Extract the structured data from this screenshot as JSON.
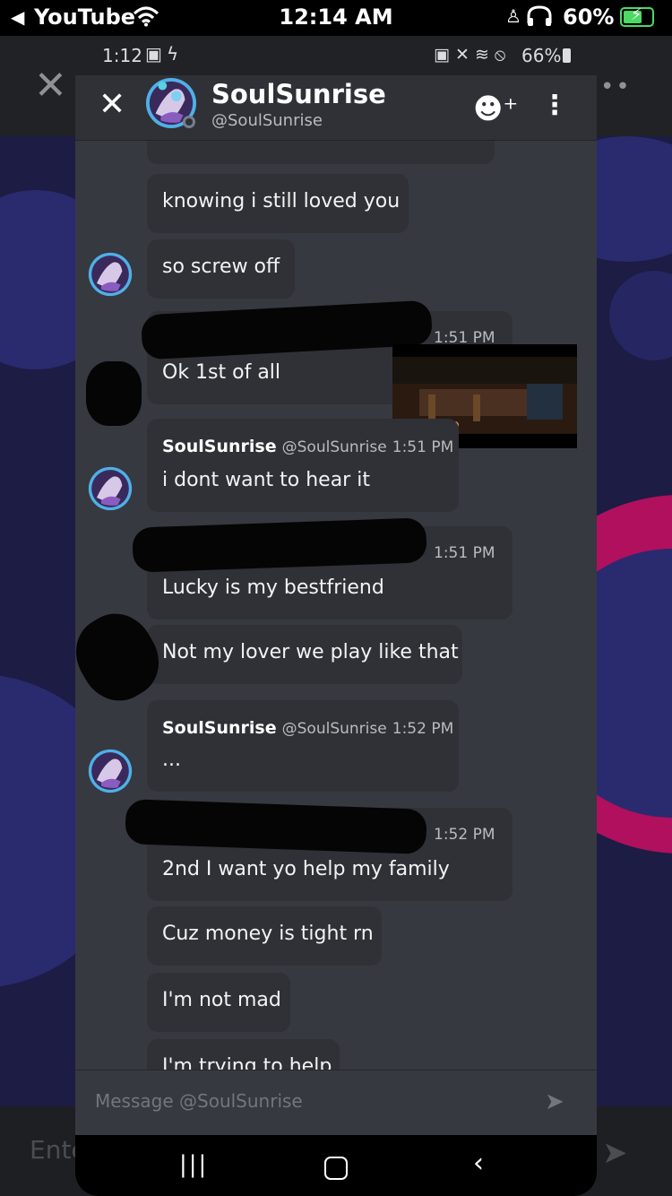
{
  "ios_status": {
    "back_label": "◀ ",
    "app": "YouTube",
    "time": "12:14 AM",
    "battery": "60%"
  },
  "outer": {
    "input_placeholder": "Ente"
  },
  "phone_status": {
    "time": "1:12",
    "battery": "66%"
  },
  "dm_header": {
    "name": "SoulSunrise",
    "handle": "@SoulSunrise"
  },
  "messages": [
    {
      "text": "knowing i still loved you"
    },
    {
      "text": "so screw off"
    },
    {
      "time": "1:51 PM",
      "text": "Ok 1st of all"
    },
    {
      "author": "SoulSunrise",
      "handle": "@SoulSunrise",
      "time": "1:51 PM",
      "text": "i dont want to hear it"
    },
    {
      "time": "1:51 PM",
      "text": "Lucky is my bestfriend"
    },
    {
      "text": "Not my lover we play like that"
    },
    {
      "author": "SoulSunrise",
      "handle": "@SoulSunrise",
      "time": "1:52 PM",
      "text": "..."
    },
    {
      "time": "1:52 PM",
      "text": "2nd I want yo help my family"
    },
    {
      "text": "Cuz money is tight rn"
    },
    {
      "text": "I'm not mad"
    },
    {
      "text": "I'm trying to help"
    }
  ],
  "composer": {
    "placeholder": "Message @SoulSunrise"
  },
  "colors": {
    "chat_bg": "#36393f",
    "bubble_bg": "#2f3136",
    "outer_bg": "#1c1c44",
    "accent_pink": "#b0105e"
  }
}
